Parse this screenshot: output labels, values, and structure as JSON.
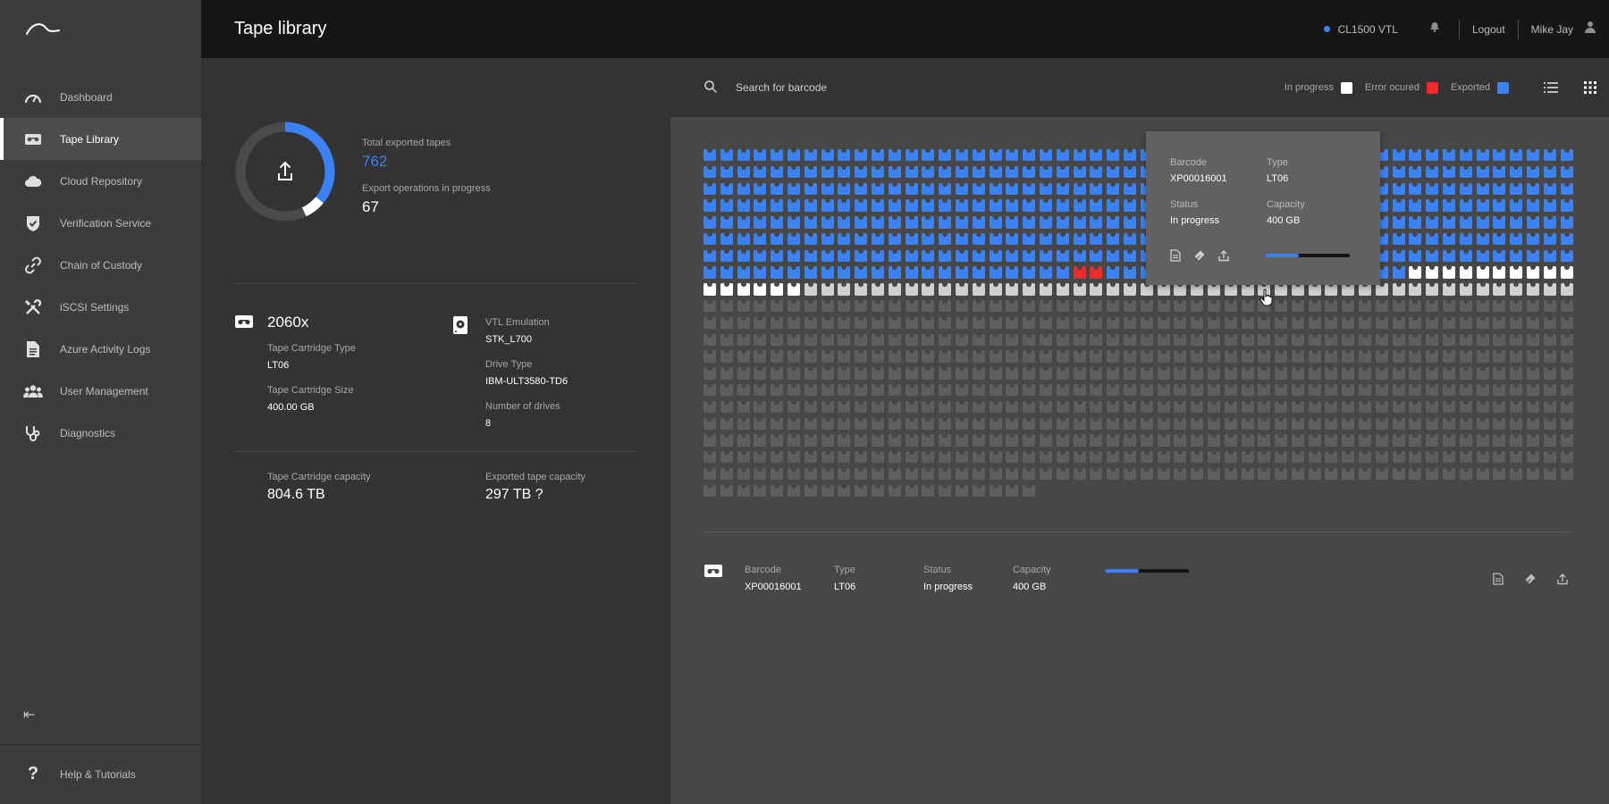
{
  "app": {
    "page_title": "Tape library"
  },
  "sidebar": {
    "items": [
      {
        "label": "Dashboard",
        "icon": "gauge-icon"
      },
      {
        "label": "Tape Library",
        "icon": "tape-cassette-icon",
        "active": true
      },
      {
        "label": "Cloud Repository",
        "icon": "cloud-icon"
      },
      {
        "label": "Verification Service",
        "icon": "shield-check-icon"
      },
      {
        "label": "Chain of Custody",
        "icon": "link-icon"
      },
      {
        "label": "iSCSI Settings",
        "icon": "tools-icon"
      },
      {
        "label": "Azure Activity Logs",
        "icon": "document-icon"
      },
      {
        "label": "User Management",
        "icon": "users-icon"
      },
      {
        "label": "Diagnostics",
        "icon": "stethoscope-icon"
      }
    ],
    "collapse_glyph": "⇤",
    "help_label": "Help & Tutorials"
  },
  "topbar": {
    "system_name": "CL1500 VTL",
    "logout_label": "Logout",
    "user_name": "Mike Jay"
  },
  "summary": {
    "total_exported_label": "Total exported tapes",
    "total_exported_value": "762",
    "ops_in_progress_label": "Export operations in progress",
    "ops_in_progress_value": "67",
    "donut": {
      "exported_fraction": 0.36,
      "in_progress_fraction": 0.07
    }
  },
  "library_info": {
    "cartridge_count": "2060x",
    "cartridge_type_label": "Tape Cartridge Type",
    "cartridge_type_value": "LT06",
    "cartridge_size_label": "Tape Cartridge Size",
    "cartridge_size_value": "400.00 GB",
    "vtl_emulation_label": "VTL Emulation",
    "vtl_emulation_value": "STK_L700",
    "drive_type_label": "Drive Type",
    "drive_type_value": "IBM-ULT3580-TD6",
    "num_drives_label": "Number of drives",
    "num_drives_value": "8"
  },
  "capacity": {
    "cartridge_capacity_label": "Tape Cartridge capacity",
    "cartridge_capacity_value": "804.6 TB",
    "exported_capacity_label": "Exported tape capacity",
    "exported_capacity_value": "297 TB ?"
  },
  "search": {
    "placeholder": "Search for barcode"
  },
  "legend": {
    "in_progress": "In progress",
    "error": "Error ocured",
    "exported": "Exported"
  },
  "colors": {
    "exported": "#3b82f6",
    "error": "#ee2b2b",
    "in_progress": "#ffffff",
    "pending": "#cfcfcf",
    "empty": "#5e5e5e"
  },
  "tape_grid": {
    "columns": 52,
    "exported_full_rows": 7,
    "row8_exported": 42,
    "row8_error_indices": [
      22,
      23
    ],
    "row9_in_progress": 6,
    "empty_row_count": 11,
    "last_row_count": 20
  },
  "tooltip": {
    "barcode_label": "Barcode",
    "barcode_value": "XP00016001",
    "type_label": "Type",
    "type_value": "LT06",
    "status_label": "Status",
    "status_value": "In progress",
    "capacity_label": "Capacity",
    "capacity_value": "400 GB",
    "progress": 0.4
  },
  "detail": {
    "barcode_label": "Barcode",
    "barcode_value": "XP00016001",
    "type_label": "Type",
    "type_value": "LT06",
    "status_label": "Status",
    "status_value": "In progress",
    "capacity_label": "Capacity",
    "capacity_value": "400 GB",
    "progress": 0.4
  }
}
